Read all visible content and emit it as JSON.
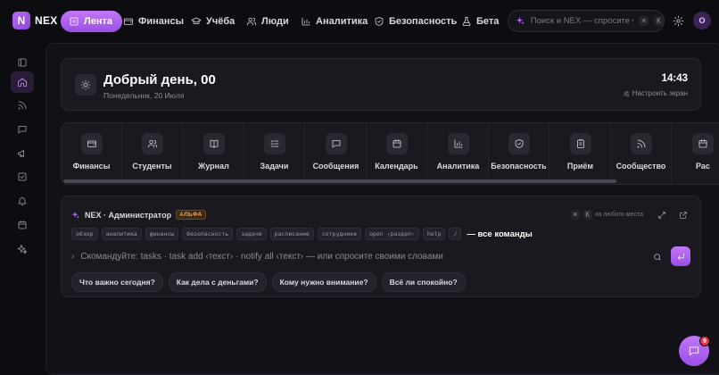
{
  "brand": {
    "logo_letter": "N",
    "name": "NEX"
  },
  "nav": {
    "items": [
      {
        "label": "Лента",
        "icon": "grid-icon",
        "active": true
      },
      {
        "label": "Финансы",
        "icon": "wallet-icon"
      },
      {
        "label": "Учёба",
        "icon": "graduation-cap-icon"
      },
      {
        "label": "Люди",
        "icon": "users-icon"
      },
      {
        "label": "Аналитика",
        "icon": "bar-chart-icon"
      },
      {
        "label": "Безопасность",
        "icon": "shield-icon"
      },
      {
        "label": "Бета",
        "icon": "flask-icon"
      }
    ],
    "search_placeholder": "Поиск и NEX — спросите что",
    "search_shortcut": [
      "⌘",
      "K"
    ],
    "avatar_initial": "O"
  },
  "sidebar": {
    "items": [
      {
        "icon": "layout-icon"
      },
      {
        "icon": "home-icon",
        "active": true
      },
      {
        "icon": "rss-icon"
      },
      {
        "icon": "message-icon"
      },
      {
        "icon": "megaphone-icon"
      },
      {
        "icon": "check-square-icon"
      },
      {
        "icon": "bell-icon"
      },
      {
        "icon": "calendar-icon"
      },
      {
        "icon": "sparkles-icon"
      }
    ]
  },
  "greeting": {
    "title": "Добрый день, 00",
    "date": "Понедельник, 20 Июля",
    "time": "14:43",
    "customize_label": "Настроить экран"
  },
  "modules": [
    {
      "label": "Финансы",
      "icon": "wallet-icon"
    },
    {
      "label": "Студенты",
      "icon": "users-icon"
    },
    {
      "label": "Журнал",
      "icon": "book-icon"
    },
    {
      "label": "Задачи",
      "icon": "list-check-icon"
    },
    {
      "label": "Сообщения",
      "icon": "message-icon"
    },
    {
      "label": "Календарь",
      "icon": "calendar-icon"
    },
    {
      "label": "Аналитика",
      "icon": "bar-chart-icon"
    },
    {
      "label": "Безопасность",
      "icon": "shield-icon"
    },
    {
      "label": "Приём",
      "icon": "clipboard-icon"
    },
    {
      "label": "Сообщество",
      "icon": "rss-icon"
    },
    {
      "label": "Рас",
      "icon": "calendar-icon"
    }
  ],
  "command": {
    "title": "NEX · Администратор",
    "badge": "АЛЬФА",
    "shortcut": [
      "⌘",
      "K"
    ],
    "shortcut_hint": "из любого места",
    "chips": [
      "обзор",
      "аналитика",
      "финансы",
      "безопасность",
      "задачи",
      "расписание",
      "сотрудники",
      "open ‹раздел›",
      "help",
      "/"
    ],
    "all_commands": "— все команды",
    "placeholder": "Скомандуйте: tasks · task add ‹текст› · notify all ‹текст› — или спросите своими словами",
    "suggestions": [
      "Что важно сегодня?",
      "Как дела с деньгами?",
      "Кому нужно внимание?",
      "Всё ли спокойно?"
    ]
  },
  "chat": {
    "badge_count": "9"
  },
  "colors": {
    "accent": "#a65ef0",
    "background": "#0d0c11",
    "card": "#1a1920",
    "badge_alpha": "#f0a64a",
    "notification": "#e0364f"
  }
}
